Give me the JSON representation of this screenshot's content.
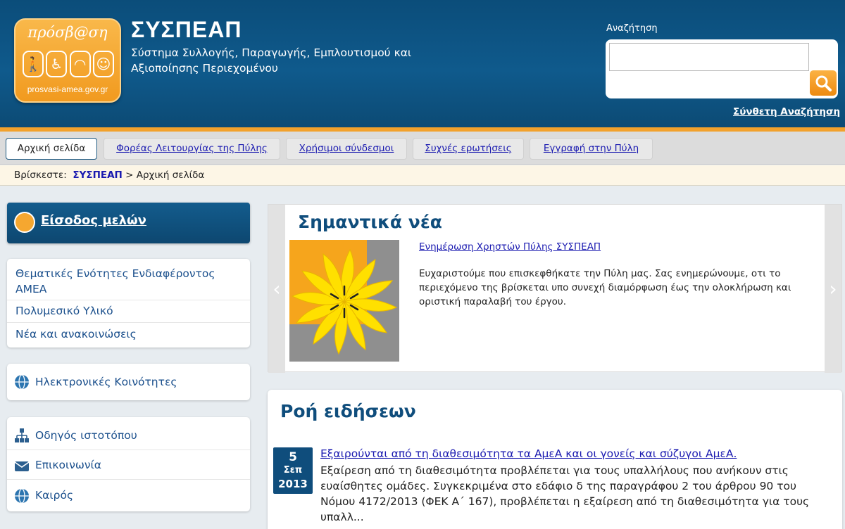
{
  "header": {
    "logo_title": "πρόσβ@ση",
    "logo_url": "prosvasi-amea.gov.gr",
    "site_name": "ΣΥΣΠΕΑΠ",
    "site_subtitle": "Σύστημα Συλλογής, Παραγωγής, Εμπλουτισμού και Αξιοποίησης Περιεχομένου",
    "search_label": "Αναζήτηση",
    "search_value": "",
    "advanced_search": "Σύνθετη Αναζήτηση"
  },
  "nav": {
    "tabs": [
      {
        "label": "Αρχική σελίδα",
        "active": true
      },
      {
        "label": "Φορέας Λειτουργίας της Πύλης",
        "active": false
      },
      {
        "label": "Χρήσιμοι σύνδεσμοι",
        "active": false
      },
      {
        "label": "Συχνές ερωτήσεις",
        "active": false
      },
      {
        "label": "Εγγραφή στην Πύλη",
        "active": false
      }
    ]
  },
  "breadcrumb": {
    "prefix": "Βρίσκεστε:",
    "root": "ΣΥΣΠΕΑΠ",
    "separator": ">",
    "current": "Αρχική σελίδα"
  },
  "sidebar": {
    "login_label": "Είσοδος μελών",
    "group1": [
      "Θεματικές Ενότητες Ενδιαφέροντος ΑΜΕΑ",
      "Πολυμεσικό Υλικό",
      "Νέα και ανακοινώσεις"
    ],
    "group2": [
      "Ηλεκτρονικές Κοινότητες"
    ],
    "group3": [
      "Οδηγός ιστοτόπου",
      "Επικοινωνία",
      "Καιρός"
    ]
  },
  "important_news": {
    "title": "Σημαντικά νέα",
    "link": "Ενημέρωση Χρηστών Πύλης ΣΥΣΠΕΑΠ",
    "body": "Ευχαριστούμε που επισκεφθήκατε την Πύλη μας. Σας ενημερώνουμε, οτι το περιεχόμενο της βρίσκεται υπο συνεχή  διαμόρφωση έως την ολοκλήρωση και οριστική παραλαβή του έργου.",
    "prev_arrow": "‹",
    "next_arrow": "›"
  },
  "news_feed": {
    "title": "Ροή ειδήσεων",
    "items": [
      {
        "day": "5",
        "month": "Σεπ",
        "year": "2013",
        "link": "Εξαιρούνται από τη διαθεσιμότητα τα ΑμεΑ και οι γονείς και σύζυγοι ΑμεΑ.",
        "body": "Εξαίρεση από τη διαθεσιμότητα προβλέπεται για τους υπαλλήλους που ανήκουν στις ευαίσθητες ομάδες. Συγκεκριμένα  στο εδάφιο δ της  παραγράφου 2 του άρθρου 90 του Νόμου 4172/2013 (ΦΕΚ Α΄ 167), προβλέπεται η εξαίρεση από τη διαθεσιμότητα για τους υπαλλ..."
      }
    ]
  },
  "colors": {
    "header_blue": "#0f5a8c",
    "accent_orange": "#f2a12c",
    "heading_blue": "#0f4d7c",
    "link_blue": "#1a1ab0"
  }
}
